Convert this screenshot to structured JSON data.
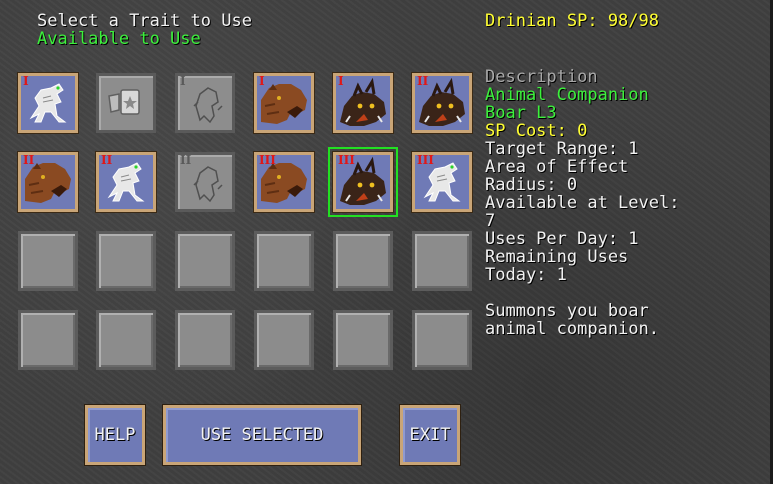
{
  "header": {
    "title": "Select a Trait to Use",
    "subtitle": "Available to Use",
    "character_sp": "Drinian SP: 98/98"
  },
  "grid": {
    "rows": [
      [
        {
          "type": "item",
          "icon": "skeletal-wolf-icon",
          "rank": "I"
        },
        {
          "type": "disabled",
          "icon": "shield-star-icon",
          "rank": ""
        },
        {
          "type": "disabled",
          "icon": "ghost-figure-icon",
          "rank": "I"
        },
        {
          "type": "item",
          "icon": "bear-icon",
          "rank": "I"
        },
        {
          "type": "item",
          "icon": "boar-icon",
          "rank": "I"
        },
        {
          "type": "item",
          "icon": "boar-icon",
          "rank": "II"
        }
      ],
      [
        {
          "type": "item",
          "icon": "bear-icon",
          "rank": "II"
        },
        {
          "type": "item",
          "icon": "skeletal-wolf-icon",
          "rank": "II"
        },
        {
          "type": "disabled",
          "icon": "ghost-figure-icon",
          "rank": "II"
        },
        {
          "type": "item",
          "icon": "bear-icon",
          "rank": "III"
        },
        {
          "type": "item",
          "icon": "boar-icon",
          "rank": "III",
          "selected": true
        },
        {
          "type": "item",
          "icon": "skeletal-wolf-icon",
          "rank": "III"
        }
      ],
      [
        {
          "type": "empty"
        },
        {
          "type": "empty"
        },
        {
          "type": "empty"
        },
        {
          "type": "empty"
        },
        {
          "type": "empty"
        },
        {
          "type": "empty"
        }
      ],
      [
        {
          "type": "empty"
        },
        {
          "type": "empty"
        },
        {
          "type": "empty"
        },
        {
          "type": "empty"
        },
        {
          "type": "empty"
        },
        {
          "type": "empty"
        }
      ]
    ]
  },
  "description": {
    "heading": "Description",
    "name": "Animal Companion",
    "subname": "Boar L3",
    "sp_cost": "SP Cost: 0",
    "target_range": "Target Range: 1",
    "area_line1": "Area of Effect",
    "area_line2": "Radius: 0",
    "level_line1": "Available at Level:",
    "level_line2": "7",
    "uses_per_day": "Uses Per Day: 1",
    "remaining_line1": "Remaining Uses",
    "remaining_line2": "Today: 1",
    "summary_line1": "Summons you boar",
    "summary_line2": "animal companion."
  },
  "buttons": {
    "help": "HELP",
    "use_selected": "USE SELECTED",
    "exit": "EXIT"
  },
  "colors": {
    "title": "#f2f2f2",
    "available": "#3df03d",
    "sp": "#ffff33",
    "slot_fill": "#6f7ab6",
    "slot_border": "#c9a577",
    "selection": "#22e022",
    "rank": "#e01818"
  }
}
